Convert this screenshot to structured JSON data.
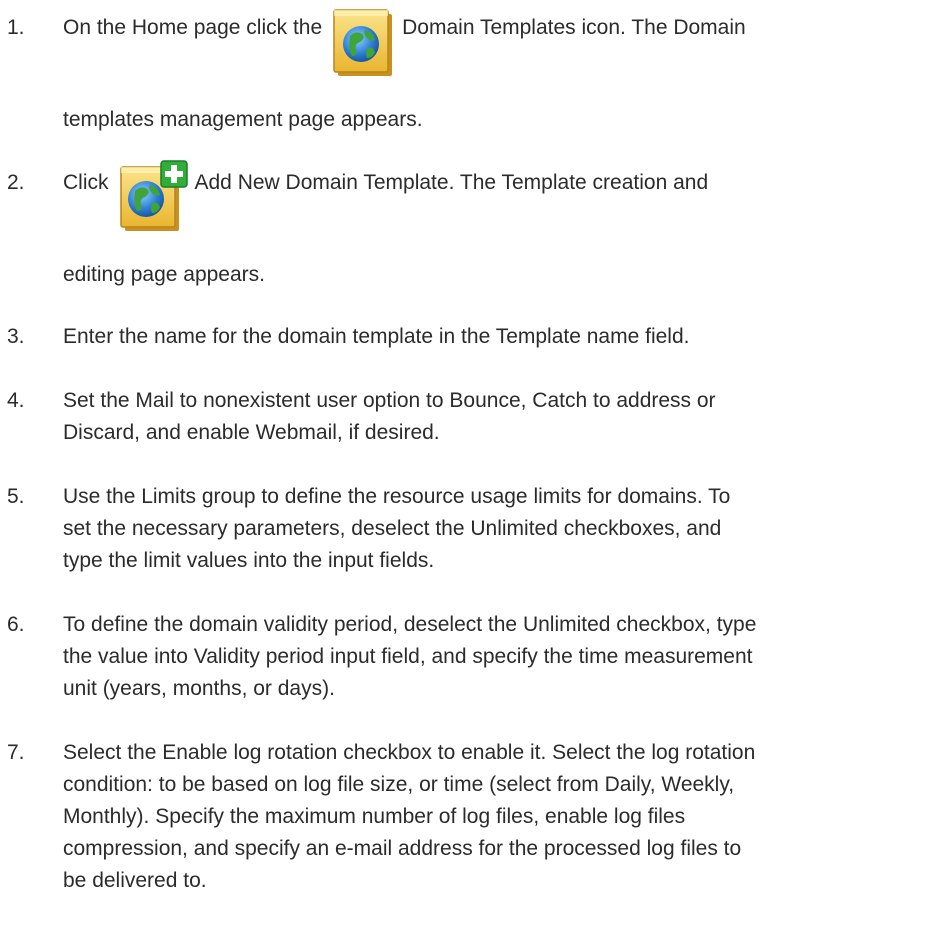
{
  "steps": [
    {
      "number": "1.",
      "before_icon": "On the Home page click the",
      "icon": "domain-templates-icon",
      "after_icon": "Domain Templates icon. The Domain",
      "continuation": "templates management page appears."
    },
    {
      "number": "2.",
      "before_icon": "Click",
      "icon": "add-new-domain-template-icon",
      "after_icon": "Add New Domain Template. The Template creation and",
      "continuation": "editing page appears."
    },
    {
      "number": "3.",
      "text": "Enter the name for the domain template in the Template name field."
    },
    {
      "number": "4.",
      "lines": [
        "Set the Mail to nonexistent user option to Bounce, Catch to address or",
        "Discard, and enable Webmail, if desired."
      ]
    },
    {
      "number": "5.",
      "lines": [
        "Use the Limits group to define the resource usage limits for domains. To",
        "set the necessary parameters, deselect the Unlimited checkboxes, and",
        "type the limit values into the input fields."
      ]
    },
    {
      "number": "6.",
      "lines": [
        "To define the domain validity period, deselect the Unlimited checkbox, type",
        "the value into Validity period input field, and specify the time measurement",
        "unit (years, months, or days)."
      ]
    },
    {
      "number": "7.",
      "lines": [
        "Select the Enable log rotation checkbox to enable it. Select the log rotation",
        "condition: to be based on log file size, or time (select from Daily, Weekly,",
        "Monthly). Specify the maximum number of log files, enable log files",
        "compression, and specify an e-mail address for the processed log files to",
        "be delivered to."
      ]
    }
  ]
}
